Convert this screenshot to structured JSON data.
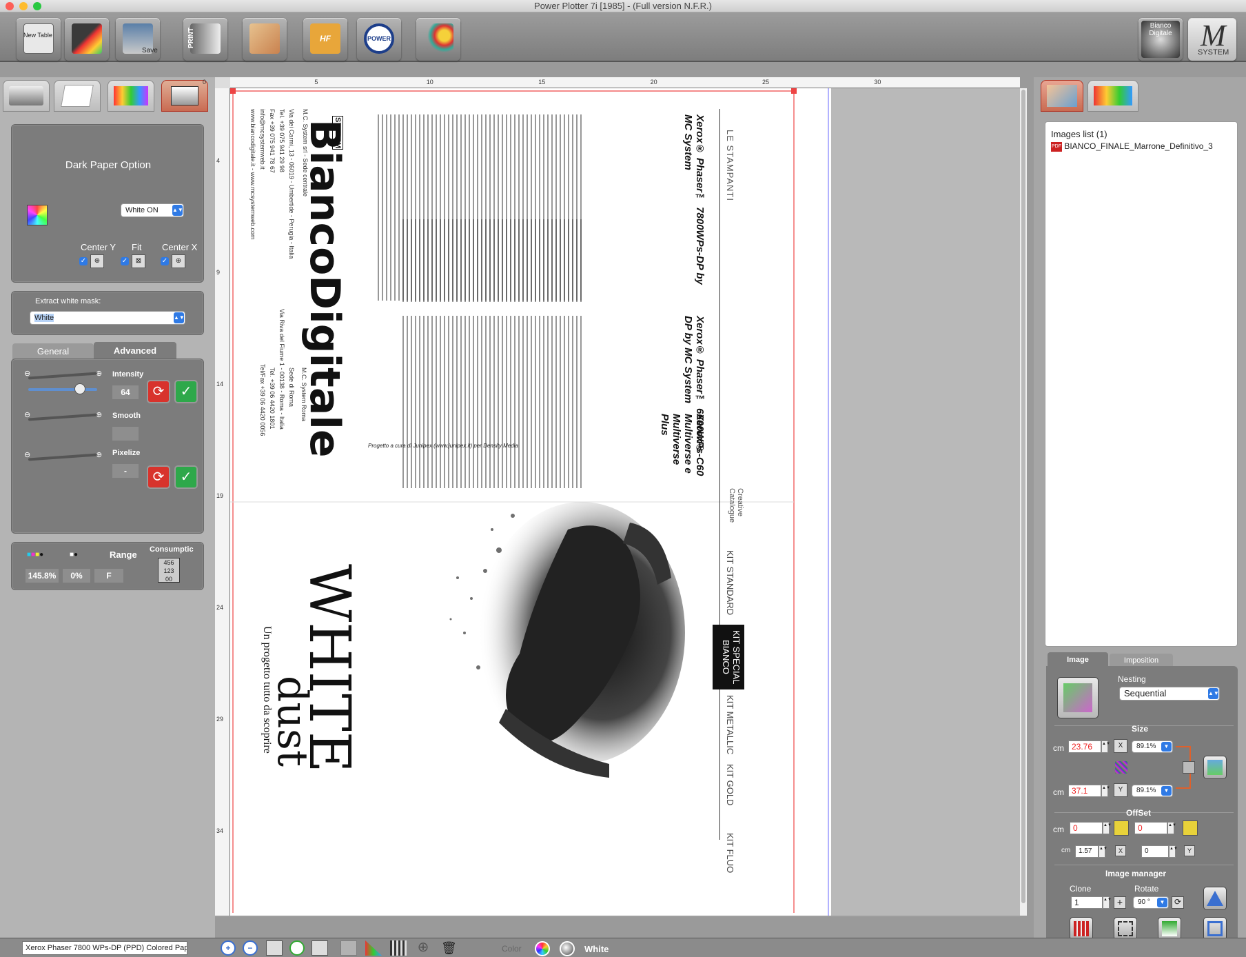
{
  "window": {
    "title": "Power Plotter 7i  [1985] - (Full version N.F.R.)"
  },
  "toolbar": {
    "new_table_label": "New Table",
    "save_label": "Save",
    "print_label": "PRINT",
    "hf_label": "HF",
    "power_label": "POWER",
    "brand_label": "Bianco Digitale",
    "brand_sub": "WP",
    "system_label": "SYSTEM"
  },
  "left": {
    "dark_paper": {
      "title": "Dark Paper Option",
      "white_select": "White ON",
      "center_y": "Center Y",
      "fit": "Fit",
      "center_x": "Center X"
    },
    "extract": {
      "label": "Extract white mask:",
      "value": "White"
    },
    "tabs": [
      "General",
      "Advanced"
    ],
    "advanced": {
      "intensity_label": "Intensity",
      "intensity_value": "64",
      "intensity_level": 0.75,
      "smooth_label": "Smooth",
      "pixelize_label": "Pixelize",
      "pixelize_value": "-"
    },
    "consumption": {
      "range_label": "Range",
      "consumption_label": "Consumptic",
      "cmyk_value": "145.8%",
      "white_value": "0%",
      "range_value": "F"
    }
  },
  "ruler": {
    "h": [
      "0",
      "5",
      "10",
      "15",
      "20",
      "25",
      "30"
    ],
    "v": [
      "4",
      "9",
      "14",
      "19",
      "24",
      "29",
      "34"
    ]
  },
  "document": {
    "brand": "BiancoDigitale",
    "system": "SYSTEM",
    "col1_title": "Xerox® Phaser™ 7800WPs-DP by MC System",
    "col2_title": "Xerox® Phaser™ 6600WPs-DP by MC System",
    "col3_title": "Xerox® C60 Multiverse e Multiverse Plus",
    "tabs": [
      "LE STAMPANTI",
      "Creative Catalogue",
      "KIT STANDARD",
      "KIT SPECIAL BIANCO",
      "KIT METALLIC",
      "KIT GOLD",
      "KIT FLUO"
    ],
    "cover_title": "WHITE",
    "cover_sub": "dust",
    "cover_tag": "Un progetto tutto da scoprire",
    "credit": "Progetto a cura di Junipex (www.junipex.it) per Density Media",
    "addr1": "M.C. System srl - Sede centrale",
    "addr2": "Via dei Carmi, 13 - 06019 - Umbertide - Perugia - Italia",
    "addr3": "Tel. +39 075 941 29 98",
    "addr4": "Fax +39 075 941 78 67",
    "addr5": "info@mcsystemweb.it",
    "addr6": "www.biancodigitale.it - www.mcsystemweb.com",
    "rome1": "M.C. System Roma",
    "rome2": "Sede di Roma",
    "rome3": "Via Riva del Fiume 1 - 00138 - Roma - Italia",
    "rome4": "Tel. +39 06 4420 1801",
    "rome5": "Tel/Fax +39 06 4420 0056"
  },
  "right": {
    "images_list_label": "Images list (1)",
    "image_file": "BIANCO_FINALE_Marrone_Definitivo_3",
    "tabs": [
      "Image",
      "Imposition"
    ],
    "nesting_label": "Nesting",
    "nesting_value": "Sequential",
    "size_label": "Size",
    "unit": "cm",
    "width": "23.76",
    "height": "37.1",
    "scale_x": "89.1%",
    "scale_y": "89.1%",
    "offset_label": "OffSet",
    "offset_x": "0",
    "offset_y": "0",
    "margin_x": "1.57",
    "margin_y": "0",
    "image_manager_label": "Image manager",
    "clone_label": "Clone",
    "clone_value": "1",
    "rotate_label": "Rotate",
    "rotate_value": "90 °"
  },
  "status": {
    "printer": "Xerox Phaser 7800 WPs-DP (PPD) Colored Pape",
    "color_label": "Color",
    "white_label": "White"
  }
}
